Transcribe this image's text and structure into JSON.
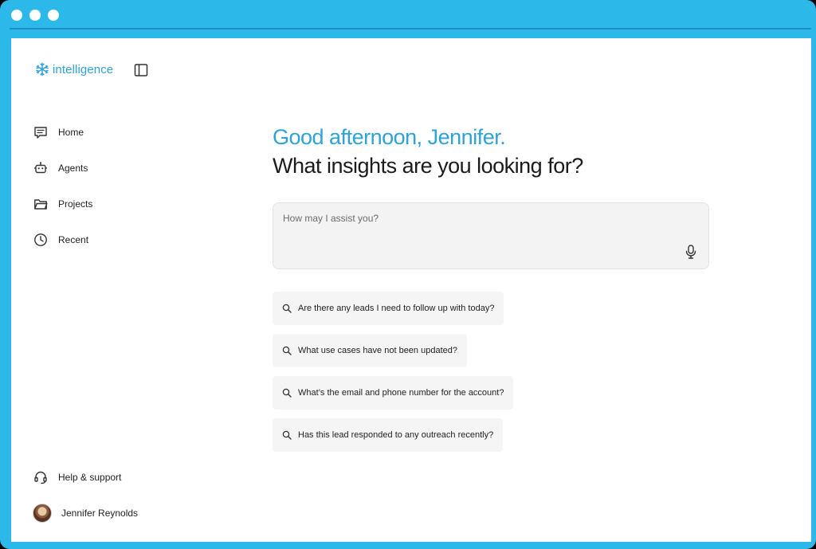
{
  "window_controls": [
    "dot",
    "dot",
    "dot"
  ],
  "brand": {
    "name": "intelligence",
    "icon": "snowflake-icon",
    "color": "#2ea3d8"
  },
  "sidebar": {
    "toggle_icon": "sidebar-panel-icon",
    "items": [
      {
        "label": "Home",
        "icon": "home-icon"
      },
      {
        "label": "Agents",
        "icon": "robot-icon"
      },
      {
        "label": "Projects",
        "icon": "folder-icon"
      },
      {
        "label": "Recent",
        "icon": "clock-icon"
      }
    ],
    "help": {
      "label": "Help & support",
      "icon": "headset-icon"
    },
    "user": {
      "name": "Jennifer Reynolds",
      "icon": "avatar"
    }
  },
  "main": {
    "greeting": "Good afternoon, Jennifer.",
    "headline": "What insights are you looking for?",
    "prompt": {
      "placeholder": "How may I assist you?",
      "value": "",
      "mic_icon": "microphone-icon"
    },
    "suggestions": [
      "Are there any leads I need to follow up with today?",
      "What use cases have not been updated?",
      "What’s the email and phone number for the account?",
      "Has this lead responded to any outreach recently?"
    ]
  },
  "colors": {
    "frame": "#2db8ea",
    "accent": "#2ea3d8",
    "text": "#1b1b1b"
  }
}
